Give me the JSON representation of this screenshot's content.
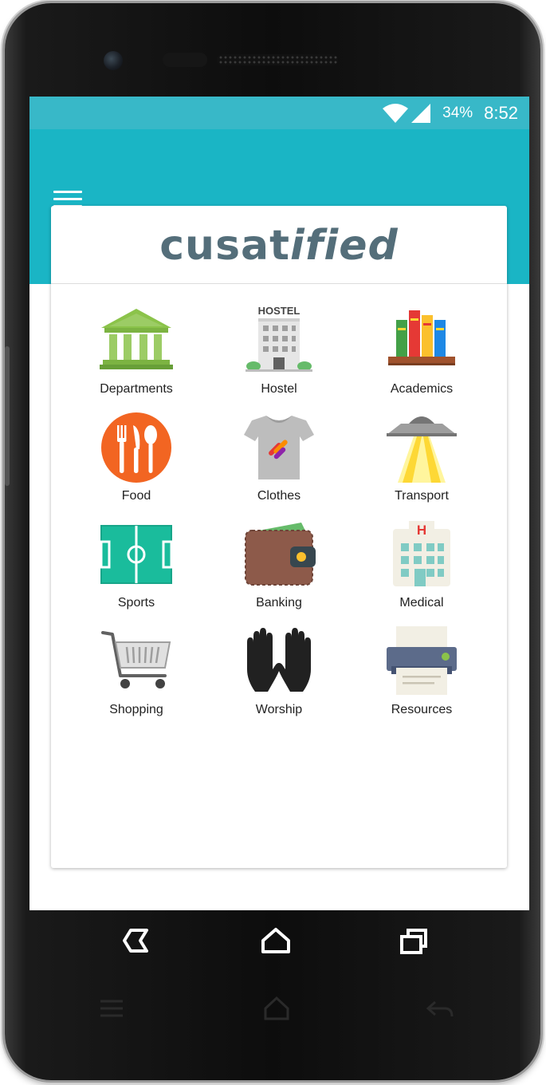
{
  "status_bar": {
    "battery": "34%",
    "time": "8:52"
  },
  "app": {
    "logo_prefix": "cusat",
    "logo_suffix": "ified"
  },
  "categories": [
    {
      "label": "Departments",
      "icon": "bank-icon"
    },
    {
      "label": "Hostel",
      "icon": "hostel-building-icon",
      "icon_text": "HOSTEL"
    },
    {
      "label": "Academics",
      "icon": "books-icon"
    },
    {
      "label": "Food",
      "icon": "fork-knife-spoon-icon"
    },
    {
      "label": "Clothes",
      "icon": "tshirt-icon"
    },
    {
      "label": "Transport",
      "icon": "ufo-icon"
    },
    {
      "label": "Sports",
      "icon": "football-field-icon"
    },
    {
      "label": "Banking",
      "icon": "wallet-icon"
    },
    {
      "label": "Medical",
      "icon": "hospital-icon",
      "icon_text": "H"
    },
    {
      "label": "Shopping",
      "icon": "shopping-cart-icon"
    },
    {
      "label": "Worship",
      "icon": "praying-hands-icon"
    },
    {
      "label": "Resources",
      "icon": "printer-icon"
    }
  ],
  "colors": {
    "status_bar": "#38b8c8",
    "app_bar": "#1ab5c5",
    "logo": "#546e7a"
  }
}
